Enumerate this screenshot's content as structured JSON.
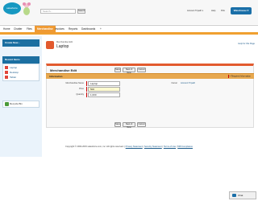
{
  "header": {
    "logo_text": "salesforce",
    "search_placeholder": "Search...",
    "search_button": "Search",
    "user_menu": "Account Tripath ▾",
    "help": "Help",
    "app_menu": "Pick",
    "app_switcher": "Warehouse ▾"
  },
  "tabs": [
    {
      "label": "Home"
    },
    {
      "label": "Chatter"
    },
    {
      "label": "Files"
    },
    {
      "label": "Merchandise"
    },
    {
      "label": "Invoices"
    },
    {
      "label": "Reports"
    },
    {
      "label": "Dashboards"
    },
    {
      "label": "+"
    }
  ],
  "sidebar": {
    "create_new": "Create New...",
    "recent_header": "Recent Items",
    "recent_items": [
      "Laptop",
      "Desktop",
      "Tablet"
    ],
    "recycle_bin": "Recycle Bin"
  },
  "page": {
    "subtitle": "Merchandise Edit",
    "title": "Laptop",
    "help_link": "Help for this Page"
  },
  "panel": {
    "title": "Merchandise Edit",
    "save": "Save",
    "save_new": "Save & New",
    "cancel": "Cancel"
  },
  "section": {
    "title": "Information",
    "required_info": "= Required Information"
  },
  "fields": {
    "name_label": "Merchandise Name",
    "name_value": "Laptop",
    "price_label": "Price",
    "price_value": "500",
    "quantity_label": "Quantity",
    "quantity_value": "1,000",
    "owner_label": "Owner",
    "owner_value": "Account Tripath"
  },
  "footer": {
    "copyright": "Copyright © 2000-2015 salesforce.com, inc. All rights reserved. |",
    "privacy": "Privacy Statement",
    "security": "Security Statement",
    "terms": "Terms of Use",
    "compliance": "508 Compliance"
  },
  "chat": {
    "label": "Chat"
  },
  "colors": {
    "accent": "#ef9a33",
    "brand_blue": "#1b6fa1",
    "record_icon": "#e25a2e"
  }
}
